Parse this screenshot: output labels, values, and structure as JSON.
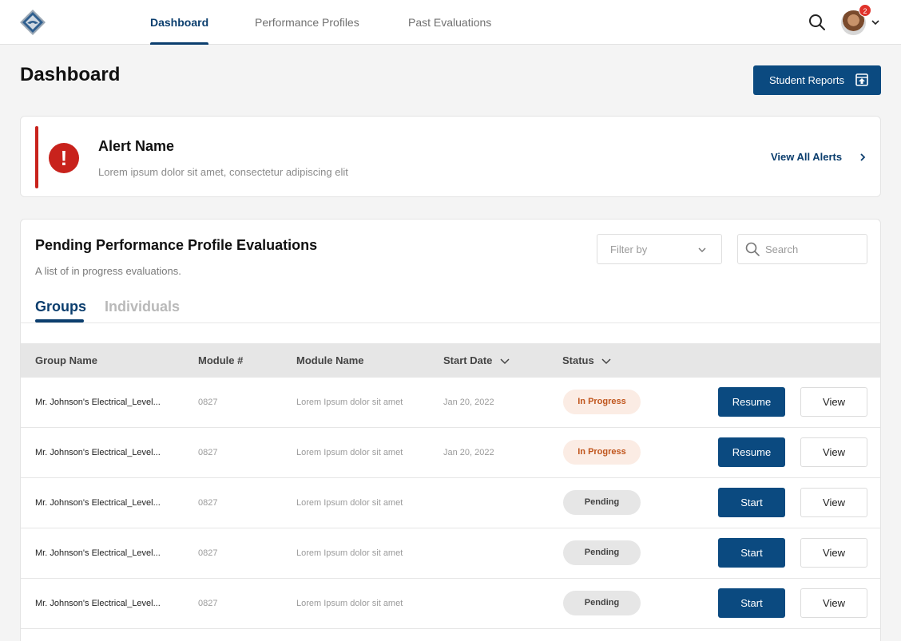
{
  "nav": {
    "tabs": [
      {
        "label": "Dashboard",
        "active": true
      },
      {
        "label": "Performance Profiles",
        "active": false
      },
      {
        "label": "Past Evaluations",
        "active": false
      }
    ],
    "notification_count": "2",
    "logo_icon": "diamond-logo-icon",
    "search_icon": "search-icon"
  },
  "page": {
    "title": "Dashboard",
    "reports_button": "Student Reports"
  },
  "alert": {
    "icon": "!",
    "title": "Alert Name",
    "description": "Lorem ipsum dolor sit amet, consectetur adipiscing elit",
    "link": "View All Alerts"
  },
  "evaluations": {
    "title": "Pending Performance Profile Evaluations",
    "subtitle": "A list of in progress evaluations.",
    "filter_placeholder": "Filter by",
    "search_placeholder": "Search",
    "tabs": [
      {
        "label": "Groups",
        "active": true
      },
      {
        "label": "Individuals",
        "active": false
      }
    ],
    "columns": [
      "Group Name",
      "Module #",
      "Module Name",
      "Start Date",
      "Status"
    ],
    "rows": [
      {
        "group": "Mr. Johnson's Electrical_Level...",
        "module_no": "0827",
        "module_name": "Lorem Ipsum dolor sit amet",
        "start_date": "Jan 20, 2022",
        "status": "In Progress",
        "action": "Resume",
        "view": "View"
      },
      {
        "group": "Mr. Johnson's Electrical_Level...",
        "module_no": "0827",
        "module_name": "Lorem Ipsum dolor sit amet",
        "start_date": "Jan 20, 2022",
        "status": "In Progress",
        "action": "Resume",
        "view": "View"
      },
      {
        "group": "Mr. Johnson's Electrical_Level...",
        "module_no": "0827",
        "module_name": "Lorem Ipsum dolor sit amet",
        "start_date": "",
        "status": "Pending",
        "action": "Start",
        "view": "View"
      },
      {
        "group": "Mr. Johnson's Electrical_Level...",
        "module_no": "0827",
        "module_name": "Lorem Ipsum dolor sit amet",
        "start_date": "",
        "status": "Pending",
        "action": "Start",
        "view": "View"
      },
      {
        "group": "Mr. Johnson's Electrical_Level...",
        "module_no": "0827",
        "module_name": "Lorem Ipsum dolor sit amet",
        "start_date": "",
        "status": "Pending",
        "action": "Start",
        "view": "View"
      }
    ]
  },
  "colors": {
    "primary": "#0b4a80",
    "alert": "#c8221c",
    "in_progress_bg": "#fbece4",
    "in_progress_text": "#c0551c"
  }
}
